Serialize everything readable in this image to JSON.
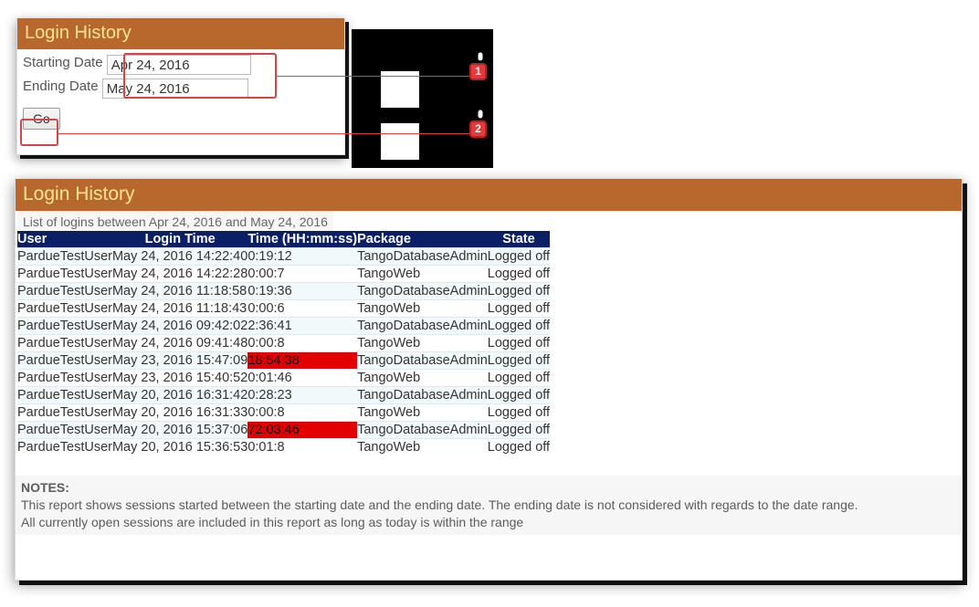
{
  "panel1": {
    "title": "Login History",
    "starting_label": "Starting Date",
    "starting_value": "Apr 24, 2016",
    "ending_label": "Ending Date",
    "ending_value": "May 24, 2016",
    "go_label": "Go"
  },
  "callouts": {
    "c1": "1",
    "c2": "2"
  },
  "panel2": {
    "title": "Login History",
    "subtitle": "List of logins between Apr 24, 2016 and May 24, 2016",
    "columns": {
      "user": "User",
      "login_time": "Login Time",
      "duration": "Time (HH:mm:ss)",
      "package": "Package",
      "state": "State"
    },
    "rows": [
      {
        "user": "PardueTestUser",
        "login_time": "May 24, 2016 14:22:40",
        "duration": "0:19:12",
        "red": false,
        "package": "TangoDatabaseAdmin",
        "state": "Logged off"
      },
      {
        "user": "PardueTestUser",
        "login_time": "May 24, 2016 14:22:28",
        "duration": "0:00:7",
        "red": false,
        "package": "TangoWeb",
        "state": "Logged off"
      },
      {
        "user": "PardueTestUser",
        "login_time": "May 24, 2016 11:18:58",
        "duration": "0:19:36",
        "red": false,
        "package": "TangoDatabaseAdmin",
        "state": "Logged off"
      },
      {
        "user": "PardueTestUser",
        "login_time": "May 24, 2016 11:18:43",
        "duration": "0:00:6",
        "red": false,
        "package": "TangoWeb",
        "state": "Logged off"
      },
      {
        "user": "PardueTestUser",
        "login_time": "May 24, 2016 09:42:02",
        "duration": "2:36:41",
        "red": false,
        "package": "TangoDatabaseAdmin",
        "state": "Logged off"
      },
      {
        "user": "PardueTestUser",
        "login_time": "May 24, 2016 09:41:48",
        "duration": "0:00:8",
        "red": false,
        "package": "TangoWeb",
        "state": "Logged off"
      },
      {
        "user": "PardueTestUser",
        "login_time": "May 23, 2016 15:47:09",
        "duration": "18:54:38",
        "red": true,
        "package": "TangoDatabaseAdmin",
        "state": "Logged off"
      },
      {
        "user": "PardueTestUser",
        "login_time": "May 23, 2016 15:40:52",
        "duration": "0:01:46",
        "red": false,
        "package": "TangoWeb",
        "state": "Logged off"
      },
      {
        "user": "PardueTestUser",
        "login_time": "May 20, 2016 16:31:42",
        "duration": "0:28:23",
        "red": false,
        "package": "TangoDatabaseAdmin",
        "state": "Logged off"
      },
      {
        "user": "PardueTestUser",
        "login_time": "May 20, 2016 16:31:33",
        "duration": "0:00:8",
        "red": false,
        "package": "TangoWeb",
        "state": "Logged off"
      },
      {
        "user": "PardueTestUser",
        "login_time": "May 20, 2016 15:37:06",
        "duration": "72:03:46",
        "red": true,
        "package": "TangoDatabaseAdmin",
        "state": "Logged off"
      },
      {
        "user": "PardueTestUser",
        "login_time": "May 20, 2016 15:36:53",
        "duration": "0:01:8",
        "red": false,
        "package": "TangoWeb",
        "state": "Logged off"
      }
    ],
    "notes_header": "NOTES:",
    "notes_line1": "This report shows sessions started between the starting date and the ending date. The ending date is not considered with regards to the date range.",
    "notes_line2": "All currently open sessions are included in this report as long as today is within the range"
  }
}
